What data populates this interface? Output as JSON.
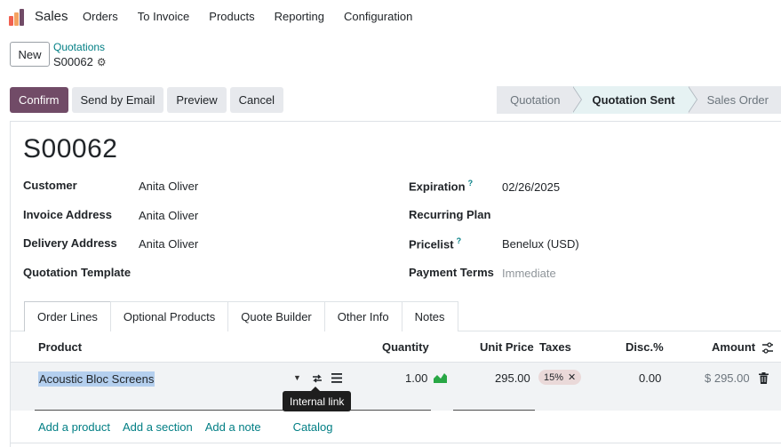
{
  "navbar": {
    "app_name": "Sales",
    "menu": [
      "Orders",
      "To Invoice",
      "Products",
      "Reporting",
      "Configuration"
    ]
  },
  "control_panel": {
    "new_label": "New",
    "breadcrumb_parent": "Quotations",
    "record_ref": "S00062"
  },
  "actions": {
    "confirm": "Confirm",
    "send_email": "Send by Email",
    "preview": "Preview",
    "cancel": "Cancel"
  },
  "statusbar": {
    "stages": [
      "Quotation",
      "Quotation Sent",
      "Sales Order"
    ],
    "active": "Quotation Sent"
  },
  "form": {
    "title": "S00062",
    "left_fields": [
      {
        "label": "Customer",
        "value": "Anita Oliver"
      },
      {
        "label": "Invoice Address",
        "value": "Anita Oliver"
      },
      {
        "label": "Delivery Address",
        "value": "Anita Oliver"
      },
      {
        "label": "Quotation Template",
        "value": ""
      }
    ],
    "right_fields": [
      {
        "label": "Expiration",
        "help": "?",
        "value": "02/26/2025"
      },
      {
        "label": "Recurring Plan",
        "value": ""
      },
      {
        "label": "Pricelist",
        "help": "?",
        "value": "Benelux (USD)"
      },
      {
        "label": "Payment Terms",
        "placeholder": "Immediate"
      }
    ]
  },
  "tabs": [
    "Order Lines",
    "Optional Products",
    "Quote Builder",
    "Other Info",
    "Notes"
  ],
  "table": {
    "headers": {
      "product": "Product",
      "quantity": "Quantity",
      "unit_price": "Unit Price",
      "taxes": "Taxes",
      "discount": "Disc.%",
      "amount": "Amount"
    },
    "rows": [
      {
        "product": "Acoustic Bloc Screens",
        "quantity": "1.00",
        "unit_price": "295.00",
        "tax": "15%",
        "discount": "0.00",
        "amount": "$ 295.00"
      }
    ],
    "tooltip": "Internal link",
    "add_links": [
      "Add a product",
      "Add a section",
      "Add a note",
      "Catalog"
    ]
  },
  "colors": {
    "primary": "#714b67",
    "link": "#017e84",
    "tax_badge": "#ead9d9",
    "selection": "#b4cfee"
  }
}
